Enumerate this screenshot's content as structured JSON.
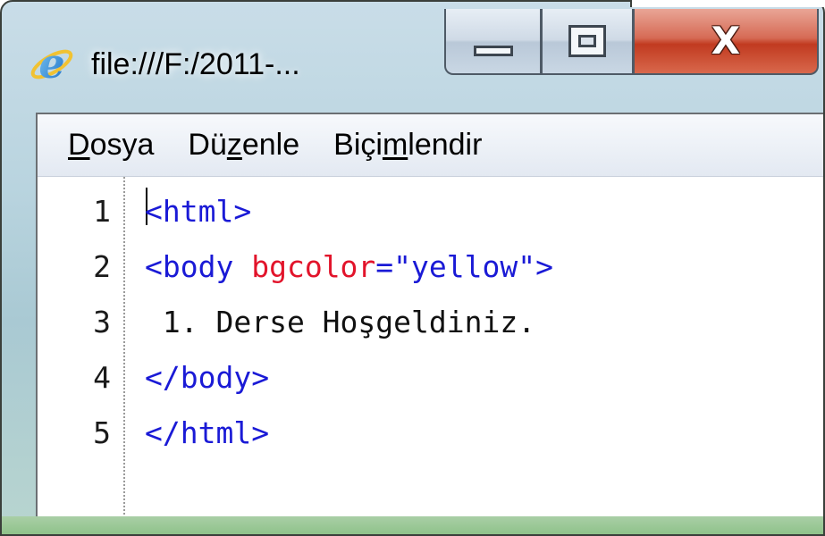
{
  "window": {
    "title": "file:///F:/2011-...",
    "icon": "internet-explorer-icon",
    "controls": {
      "minimize_icon": "minimize-icon",
      "maximize_icon": "maximize-icon",
      "close_icon": "close-icon",
      "close_glyph": "X"
    }
  },
  "menu": {
    "items": [
      {
        "pre": "",
        "u": "D",
        "post": "osya"
      },
      {
        "pre": "Dü",
        "u": "z",
        "post": "enle"
      },
      {
        "pre": "Biçi",
        "u": "m",
        "post": "lendir"
      }
    ]
  },
  "editor": {
    "line_numbers": [
      "1",
      "2",
      "3",
      "4",
      "5"
    ],
    "lines": [
      {
        "tag_open": "<html>"
      },
      {
        "tag_start": "<body ",
        "attr": "bgcolor",
        "eq_val": "=\"yellow\">"
      },
      {
        "text": " 1. Derse Hoşgeldiniz."
      },
      {
        "tag_close": "</body>"
      },
      {
        "tag_close": "</html>"
      }
    ]
  },
  "colors": {
    "tag": "#1a1ad6",
    "attribute": "#e2142b",
    "text": "#111111",
    "close_button": "#c13a20"
  }
}
